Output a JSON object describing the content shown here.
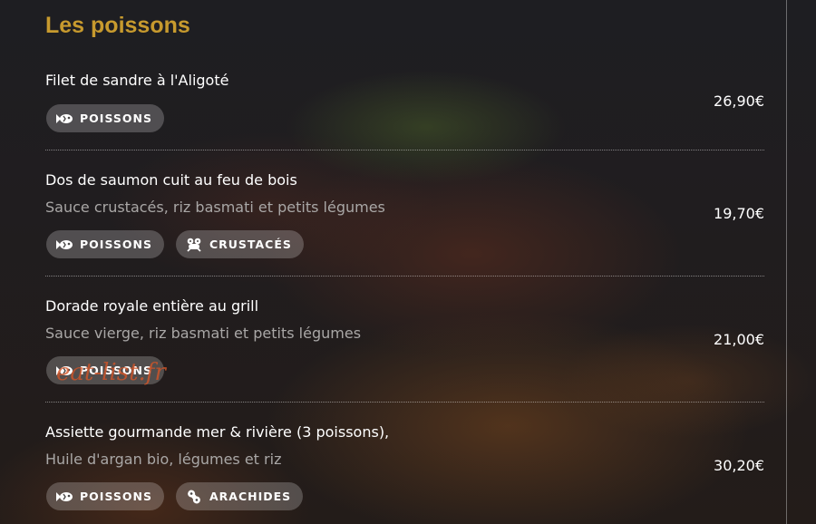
{
  "section_title": "Les poissons",
  "items": [
    {
      "name": "Filet de sandre à l'Aligoté",
      "description": "",
      "price": "26,90€",
      "tags": [
        {
          "label": "POISSONS",
          "icon": "fish-icon"
        }
      ]
    },
    {
      "name": "Dos de saumon cuit au feu de bois",
      "description": "Sauce crustacés, riz basmati et petits légumes",
      "price": "19,70€",
      "tags": [
        {
          "label": "POISSONS",
          "icon": "fish-icon"
        },
        {
          "label": "CRUSTACÉS",
          "icon": "shrimp-icon"
        }
      ]
    },
    {
      "name": "Dorade royale entière au grill",
      "description": "Sauce vierge, riz basmati et petits légumes",
      "price": "21,00€",
      "tags": [
        {
          "label": "POISSONS",
          "icon": "fish-icon"
        }
      ]
    },
    {
      "name": "Assiette gourmande mer & rivière (3 poissons),",
      "description": "Huile d'argan bio, légumes et riz",
      "price": "30,20€",
      "tags": [
        {
          "label": "POISSONS",
          "icon": "fish-icon"
        },
        {
          "label": "ARACHIDES",
          "icon": "peanut-icon"
        }
      ]
    }
  ],
  "watermark": "eat-list.fr",
  "colors": {
    "accent": "#c79a2e",
    "text": "#ffffff",
    "muted": "#a9a7a6",
    "tag_bg": "rgba(255,255,255,0.22)"
  }
}
